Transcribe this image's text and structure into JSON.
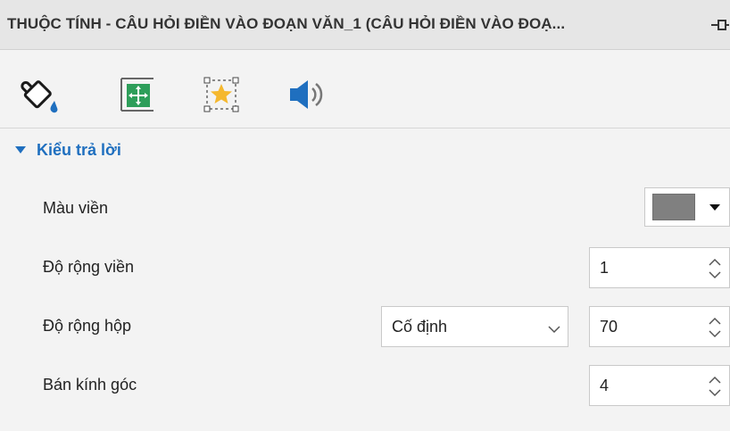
{
  "panel": {
    "title": "THUỘC TÍNH - CÂU HỎI ĐIỀN VÀO ĐOẠN VĂN_1 (CÂU HỎI ĐIỀN VÀO ĐOẠ..."
  },
  "toolbar": {
    "tabs": [
      {
        "icon": "paint-bucket-icon"
      },
      {
        "icon": "size-position-icon"
      },
      {
        "icon": "star-frame-icon"
      },
      {
        "icon": "speaker-icon"
      }
    ]
  },
  "section": {
    "label": "Kiểu trả lời"
  },
  "properties": {
    "border_color": {
      "label": "Màu viền",
      "value": "#808080"
    },
    "border_width": {
      "label": "Độ rộng viền",
      "value": "1"
    },
    "box_width": {
      "label": "Độ rộng hộp",
      "mode": "Cố định",
      "value": "70"
    },
    "corner_radius": {
      "label": "Bán kính góc",
      "value": "4"
    }
  },
  "colors": {
    "accent": "#1f6fbf",
    "panel_bg": "#f3f3f3",
    "header_bg": "#e6e6e6"
  }
}
